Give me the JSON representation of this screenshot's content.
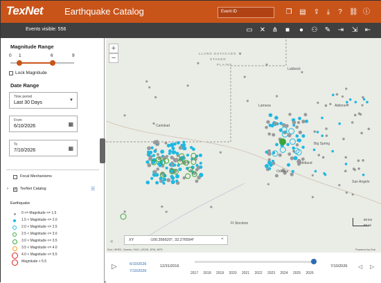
{
  "header": {
    "logo": "TexNet",
    "title": "Earthquake Catalog",
    "event_placeholder": "Event ID"
  },
  "subbar": {
    "events_visible": "Events visible: 556"
  },
  "magnitude": {
    "title": "Magnitude Range",
    "min": "0",
    "low": "1",
    "high": "6",
    "max": "9",
    "lock_label": "Lock Magnitude"
  },
  "date": {
    "title": "Date Range",
    "period_label": "Time period",
    "period_value": "Last 30 Days",
    "from_label": "From",
    "from_value": "6/10/2026",
    "to_label": "To",
    "to_value": "7/10/2026"
  },
  "layers": {
    "focal": "Focal Mechanisms",
    "catalog": "TexNet Catalog"
  },
  "legend": {
    "title": "Earthquake",
    "items": [
      {
        "label": "0 <= Magnitude <= 1.5",
        "color": "#9a9a9a"
      },
      {
        "label": "1.5 < Magnitude <= 2.0",
        "color": "#1fb8e0"
      },
      {
        "label": "2.0 < Magnitude <= 2.5",
        "color": "#1fb8e0"
      },
      {
        "label": "2.5 < Magnitude <= 3.0",
        "color": "#3aa53a"
      },
      {
        "label": "3.0 < Magnitude <= 3.5",
        "color": "#3aa53a"
      },
      {
        "label": "3.5 < Magnitude <= 4.0",
        "color": "#f0a21e"
      },
      {
        "label": "4.0 < Magnitude <= 5.5",
        "color": "#d62020"
      },
      {
        "label": "Magnitude > 5.5",
        "color": "#d62020"
      }
    ]
  },
  "map": {
    "labels": [
      "LLANO ESTACADO",
      "STAKED",
      "PLAINS",
      "Lubbock",
      "Midland",
      "Odessa",
      "Carlsbad",
      "Lamesa",
      "Abilene",
      "Big Spring",
      "Ft Stockton",
      "San Angelo"
    ],
    "xy_label": "XY",
    "xy_coords": "-100.356620°, 32.276594°",
    "attribution": "Esri, HERE, Garmin, FAO, USGS, EPA, NPS",
    "powered": "Powered by Esri",
    "scale_km": "50 km",
    "scale_mi": "50 mi"
  },
  "timeline": {
    "start_a": "6/10/2026",
    "start_b": "7/10/2026",
    "range_start": "12/31/2016",
    "range_end": "7/10/2026",
    "years": [
      "2017",
      "2018",
      "2019",
      "2020",
      "2021",
      "2022",
      "2023",
      "2024",
      "2025",
      "2026"
    ]
  }
}
